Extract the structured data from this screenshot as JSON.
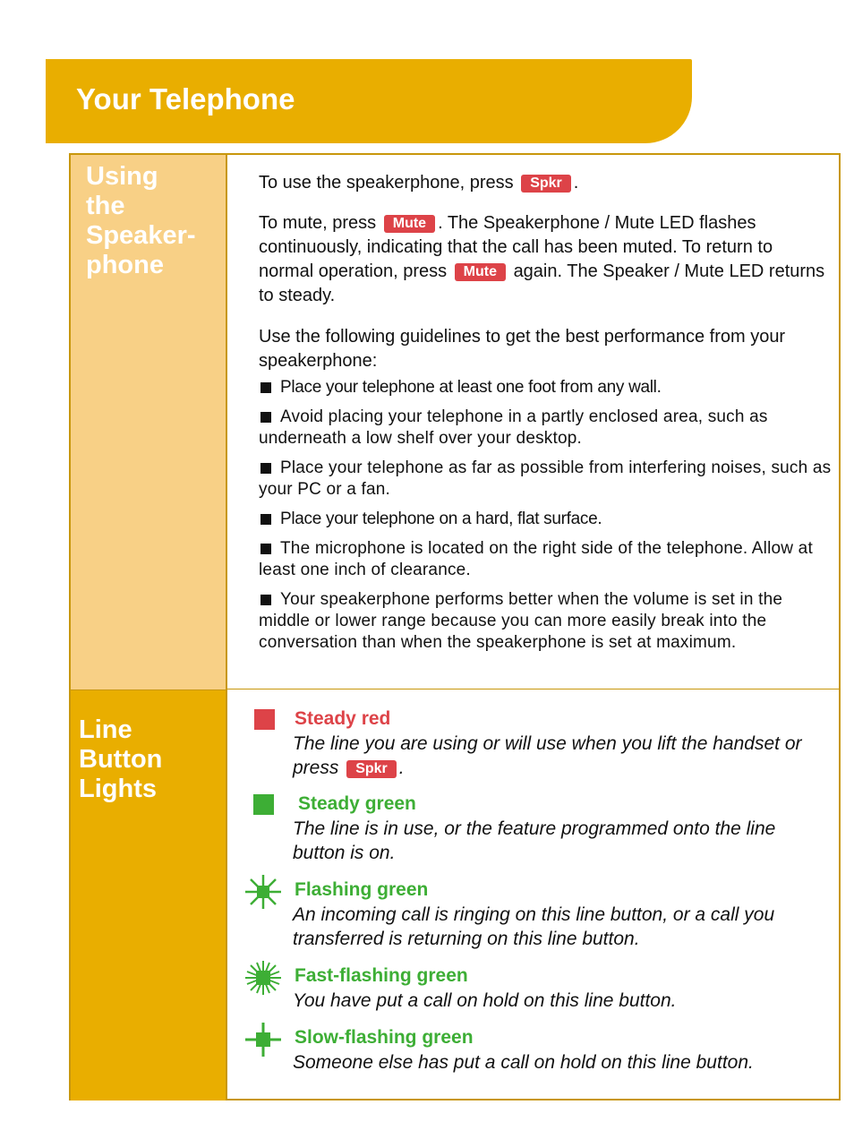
{
  "header": {
    "title": "Your Telephone",
    "color": "#E9AE00"
  },
  "sections": {
    "speakerphone": {
      "title_lines": [
        "Using",
        "the",
        "Speaker-",
        "phone"
      ],
      "para1": {
        "before": "To use the speakerphone, press",
        "key": "Spkr",
        "after": "."
      },
      "para2": {
        "before": "To mute, press",
        "key1": "Mute",
        "middle": ". The Speakerphone / Mute LED flashes continuously, indicating that the call has been muted. To return to normal operation, press",
        "key2": "Mute",
        "after": "again. The Speaker / Mute LED returns to steady."
      },
      "para3": "Use the following guidelines to get the best performance from your speakerphone:",
      "bullets": [
        "Place your telephone at least one foot from any wall.",
        "Avoid placing your telephone in a partly enclosed area, such as underneath a low shelf over your desktop.",
        "Place your telephone as far as possible from interfering noises, such as your PC or a fan.",
        "Place your telephone on a hard, flat surface.",
        "The microphone is located on the right side of the telephone. Allow at least one inch of clearance.",
        "Your speakerphone performs better when the volume is set in the middle or lower range because you can more easily break into the conversation than when the speakerphone is set at maximum."
      ]
    },
    "line_lights": {
      "title_lines": [
        "Line",
        "Button",
        "Lights"
      ],
      "items": [
        {
          "icon": "steady-red-square-icon",
          "label": "Steady red",
          "color": "#DD4348",
          "desc_before": "The line you are using or will use when you lift the handset or press",
          "key": "Spkr",
          "desc_after": "."
        },
        {
          "icon": "steady-green-square-icon",
          "label": "Steady green",
          "color": "#3DAE35",
          "desc": "The line is in use, or the feature programmed onto the line button is on."
        },
        {
          "icon": "flashing-green-icon",
          "label": "Flashing green",
          "color": "#3DAE35",
          "desc": "An incoming call is ringing on this line button, or a call you transferred is returning on this line button."
        },
        {
          "icon": "fast-flashing-green-icon",
          "label": "Fast-flashing green",
          "color": "#3DAE35",
          "desc": "You have put a call on hold on this line button."
        },
        {
          "icon": "slow-flashing-green-icon",
          "label": "Slow-flashing green",
          "color": "#3DAE35",
          "desc": "Someone else has put a call on hold on this line button."
        }
      ]
    }
  },
  "colors": {
    "key_red": "#DD4348",
    "green": "#3DAE35",
    "gold": "#E9AE00",
    "light_gold": "#F8D086",
    "border": "#C8970C"
  }
}
